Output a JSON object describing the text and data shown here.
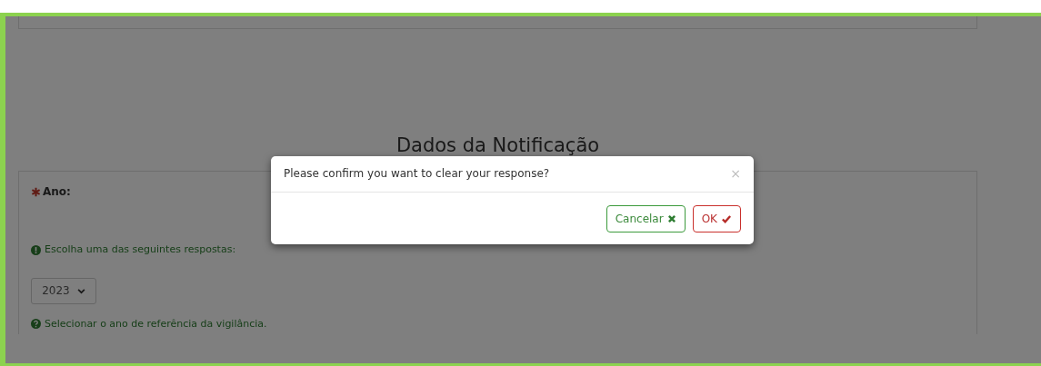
{
  "section_title": "Dados da Notificação",
  "question": {
    "label": "Ano:",
    "required": true,
    "instruction": "Escolha uma das seguintes respostas:",
    "select_value": "2023",
    "help": "Selecionar o ano de referência da vigilância."
  },
  "dialog": {
    "message": "Please confirm you want to clear your response?",
    "close": "×",
    "buttons": [
      {
        "label": "Cancelar",
        "kind": "cancel"
      },
      {
        "label": "OK",
        "kind": "ok"
      }
    ]
  }
}
